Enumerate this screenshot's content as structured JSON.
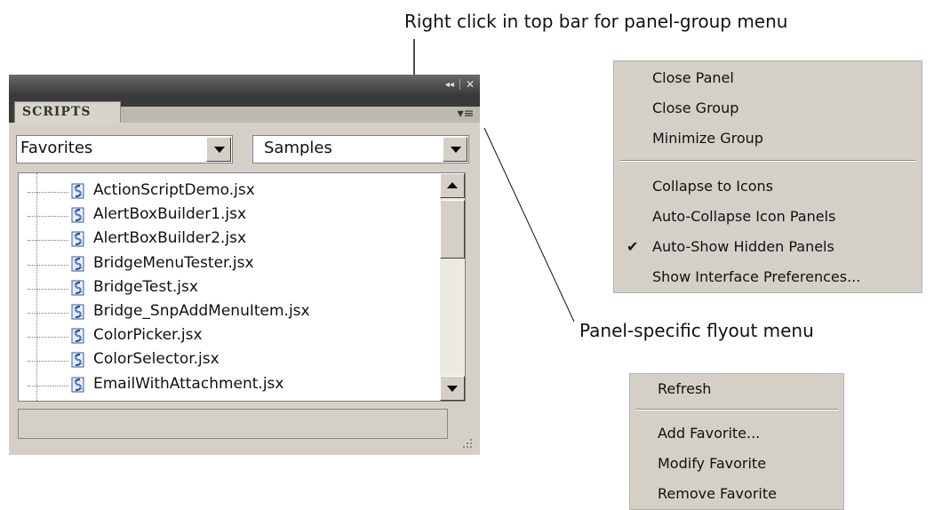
{
  "captions": {
    "top": "Right click in top bar for panel-group menu",
    "flyout": "Panel-specific flyout menu"
  },
  "panel": {
    "tab_label": "SCRIPTS",
    "topbar_icons": [
      "collapse-icon",
      "close-icon"
    ],
    "collapse_glyph": "◂◂",
    "close_glyph": "✕",
    "flyout_glyph": "▾≡",
    "dropdown_left": "Favorites",
    "dropdown_right": "Samples",
    "files": [
      "ActionScriptDemo.jsx",
      "AlertBoxBuilder1.jsx",
      "AlertBoxBuilder2.jsx",
      "BridgeMenuTester.jsx",
      "BridgeTest.jsx",
      "Bridge_SnpAddMenuItem.jsx",
      "ColorPicker.jsx",
      "ColorSelector.jsx",
      "EmailWithAttachment.jsx"
    ]
  },
  "group_menu": {
    "items": [
      {
        "label": "Close Panel"
      },
      {
        "label": "Close Group"
      },
      {
        "label": "Minimize Group"
      },
      {
        "label": "Collapse to Icons"
      },
      {
        "label": "Auto-Collapse Icon Panels"
      },
      {
        "label": "Auto-Show Hidden Panels",
        "checked": true
      },
      {
        "label": "Show Interface Preferences..."
      }
    ],
    "check_glyph": "✔"
  },
  "flyout_menu": {
    "items": [
      {
        "label": "Refresh"
      },
      {
        "label": "Add Favorite..."
      },
      {
        "label": "Modify Favorite"
      },
      {
        "label": "Remove Favorite"
      }
    ]
  }
}
